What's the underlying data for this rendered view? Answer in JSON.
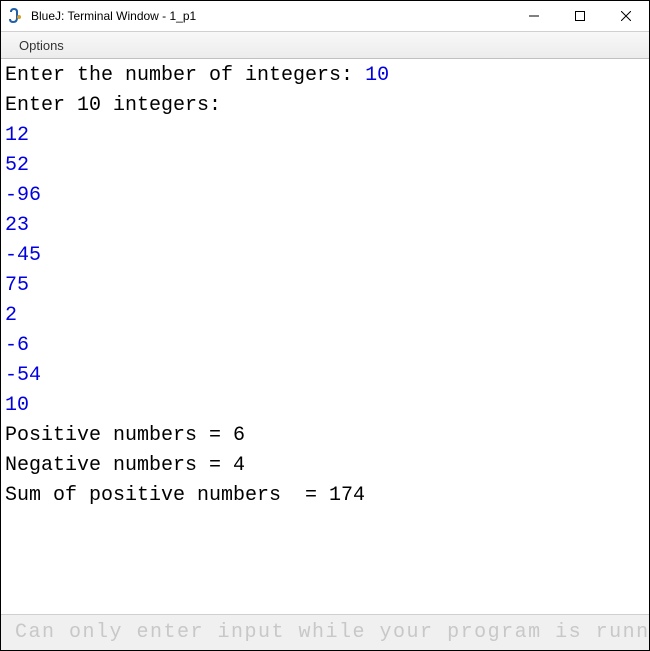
{
  "window": {
    "title": "BlueJ: Terminal Window - 1_p1"
  },
  "menu": {
    "options": "Options"
  },
  "terminal": {
    "prompt1": "Enter the number of integers: ",
    "input1": "10",
    "prompt2": "Enter 10 integers:",
    "values": [
      "12",
      "52",
      "-96",
      "23",
      "-45",
      "75",
      "2",
      "-6",
      "-54",
      "10"
    ],
    "result1": "Positive numbers = 6",
    "result2": "Negative numbers = 4",
    "result3": "Sum of positive numbers  = 174"
  },
  "status": {
    "text": "Can only enter input while your program is running"
  }
}
